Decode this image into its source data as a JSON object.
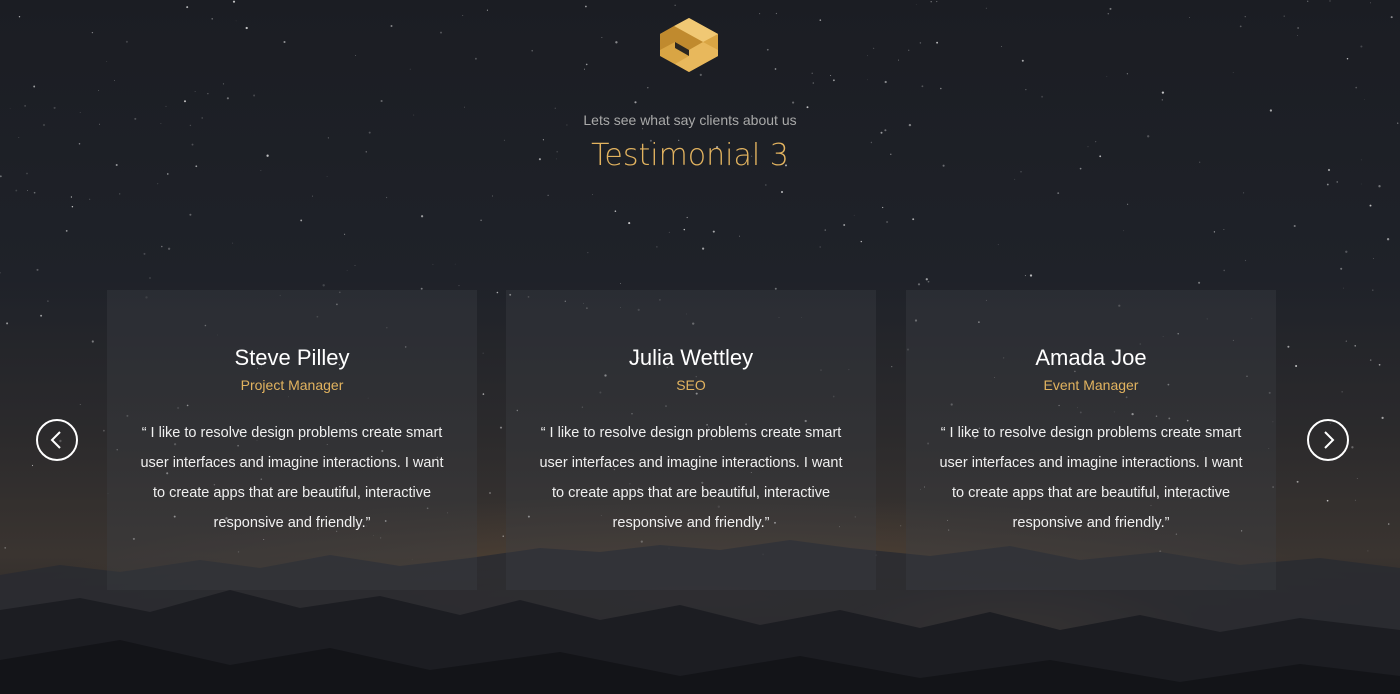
{
  "section": {
    "subtitle": "Lets see what say clients about us",
    "title": "Testimonial 3"
  },
  "colors": {
    "accent": "#e2b35f",
    "text": "#ffffff",
    "muted": "#a9a9a9"
  },
  "icons": {
    "logo": "logo-icon",
    "prev": "chevron-left-icon",
    "next": "chevron-right-icon"
  },
  "testimonials": [
    {
      "name": "Steve Pilley",
      "role": "Project Manager",
      "quote": "“ I like to resolve design problems create smart user interfaces and imagine interactions. I want to create apps that are beautiful, interactive responsive and friendly.”"
    },
    {
      "name": "Julia Wettley",
      "role": "SEO",
      "quote": "“ I like to resolve design problems create smart user interfaces and imagine interactions. I want to create apps that are beautiful, interactive responsive and friendly.”"
    },
    {
      "name": "Amada Joe",
      "role": "Event Manager",
      "quote": "“ I like to resolve design problems create smart user interfaces and imagine interactions. I want to create apps that are beautiful, interactive responsive and friendly.”"
    }
  ]
}
